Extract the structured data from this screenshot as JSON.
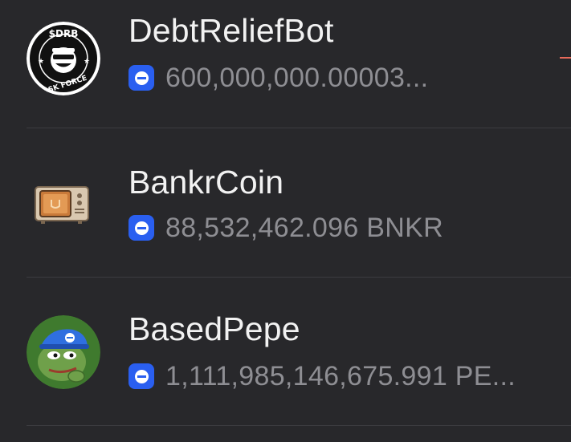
{
  "tokens": [
    {
      "name": "DebtReliefBot",
      "balance": "600,000,000.00003...",
      "logo_text": "$DRB",
      "logo_subtext": "TASK FORCE"
    },
    {
      "name": "BankrCoin",
      "balance": "88,532,462.096 BNKR"
    },
    {
      "name": "BasedPepe",
      "balance": "1,111,985,146,675.991 PE..."
    }
  ],
  "icons": {
    "chain": "base-chain-icon"
  },
  "colors": {
    "background": "#28282b",
    "name_text": "#f2f2f2",
    "balance_text": "#8e8e93",
    "chain_icon": "#2a5ff0",
    "negative_change": "#e86a5a"
  }
}
